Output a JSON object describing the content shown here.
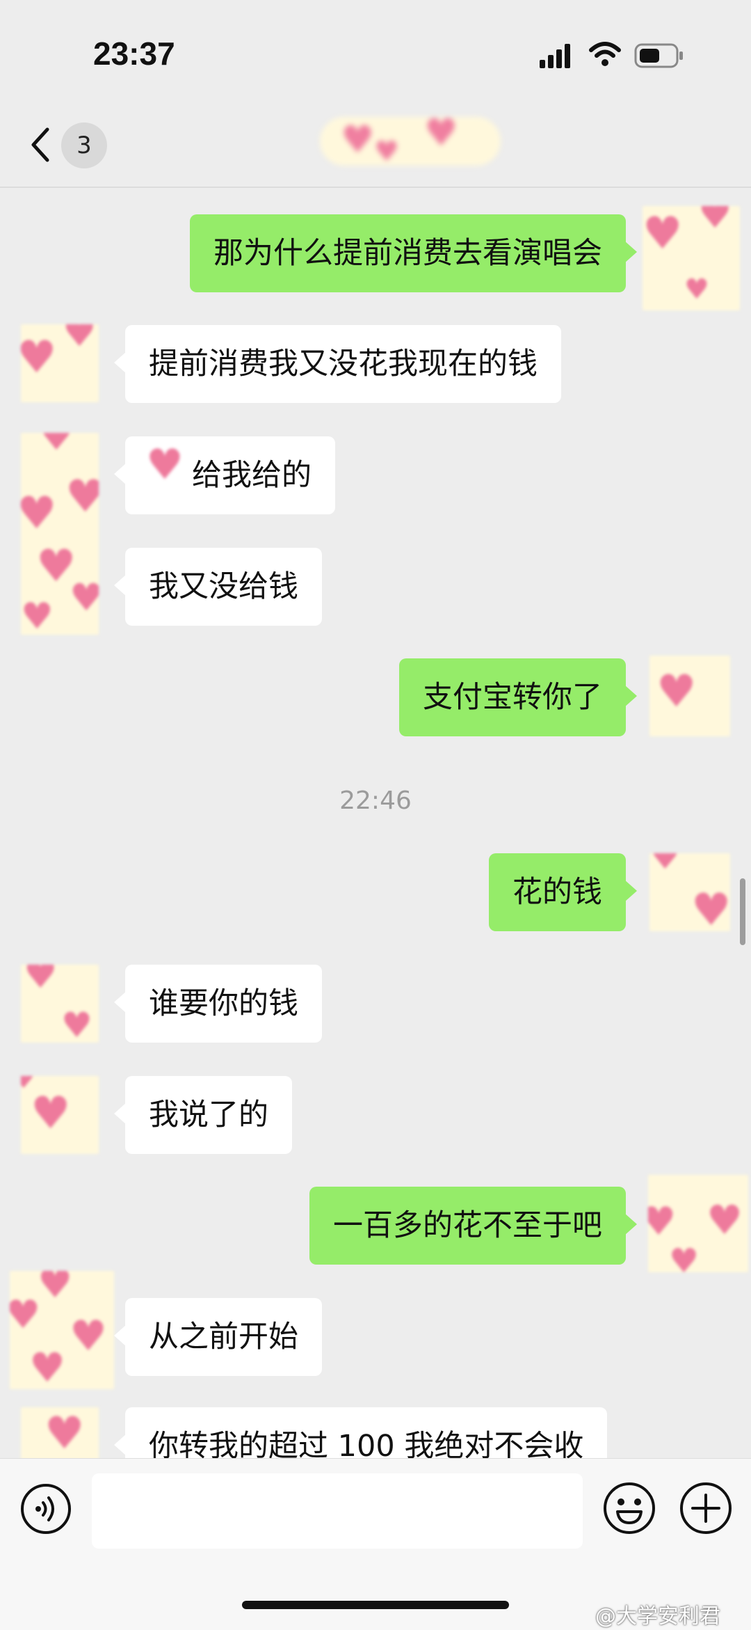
{
  "status_bar": {
    "time": "23:37"
  },
  "nav": {
    "unread_count": "3",
    "title_icon": "sticker-hearts-obscured"
  },
  "messages": {
    "m0": "那为什么提前消费去看演唱会",
    "m1": "提前消费我又没花我现在的钱",
    "m2": "给我给的",
    "m3": "我又没给钱",
    "m4": "支付宝转你了",
    "ts": "22:46",
    "m5": "花的钱",
    "m6": "谁要你的钱",
    "m7": "我说了的",
    "m8": "一百多的花不至于吧",
    "m9": "从之前开始",
    "m10": "你转我的超过 100 我绝对不会收"
  },
  "watermark": "@大学安利君",
  "colors": {
    "background": "#ededed",
    "outgoing_bubble": "#95ec69",
    "incoming_bubble": "#ffffff",
    "avatar_bg": "#fff8dc",
    "heart": "#ee7a9c"
  },
  "icons": {
    "back": "chevron-left-icon",
    "more": "more-dots-icon",
    "voice": "voice-input-icon",
    "emoji": "emoji-icon",
    "plus": "plus-icon"
  }
}
